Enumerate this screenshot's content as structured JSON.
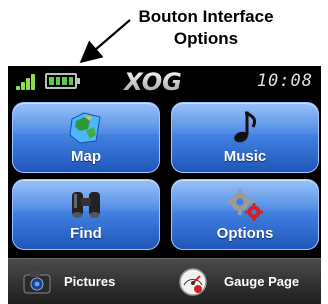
{
  "annotation": {
    "line1": "Bouton Interface",
    "line2": "Options"
  },
  "status_bar": {
    "brand": "XOG",
    "time": "10:08"
  },
  "tiles": [
    {
      "id": "map",
      "label": "Map",
      "icon": "map-icon"
    },
    {
      "id": "music",
      "label": "Music",
      "icon": "music-note-icon"
    },
    {
      "id": "find",
      "label": "Find",
      "icon": "binoculars-icon"
    },
    {
      "id": "options",
      "label": "Options",
      "icon": "gears-icon"
    }
  ],
  "bottom_bar": {
    "pictures_label": "Pictures",
    "gauge_label": "Gauge Page"
  },
  "colors": {
    "tile_blue": "#3f7fe0",
    "signal_green": "#8ee04a",
    "battery_green": "#62c84a"
  }
}
